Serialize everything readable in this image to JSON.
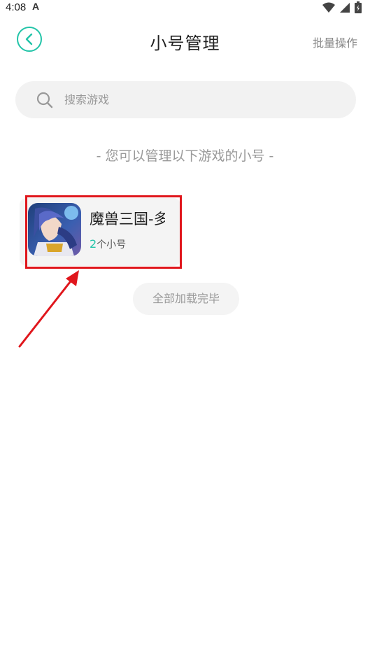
{
  "status_bar": {
    "time": "4:08",
    "app_icon_glyph": "A",
    "icons": [
      "wifi-icon",
      "signal-icon",
      "battery-icon"
    ]
  },
  "header": {
    "back_icon": "chevron-left-icon",
    "title": "小号管理",
    "batch_label": "批量操作"
  },
  "search": {
    "icon": "search-icon",
    "placeholder": "搜索游戏"
  },
  "hint": "- 您可以管理以下游戏的小号 -",
  "games": [
    {
      "name": "魔兽三国-多",
      "count": "2",
      "count_suffix": "个小号"
    }
  ],
  "footer_status": "全部加载完毕",
  "colors": {
    "accent": "#22c4a8",
    "annotation": "#e0161c"
  }
}
